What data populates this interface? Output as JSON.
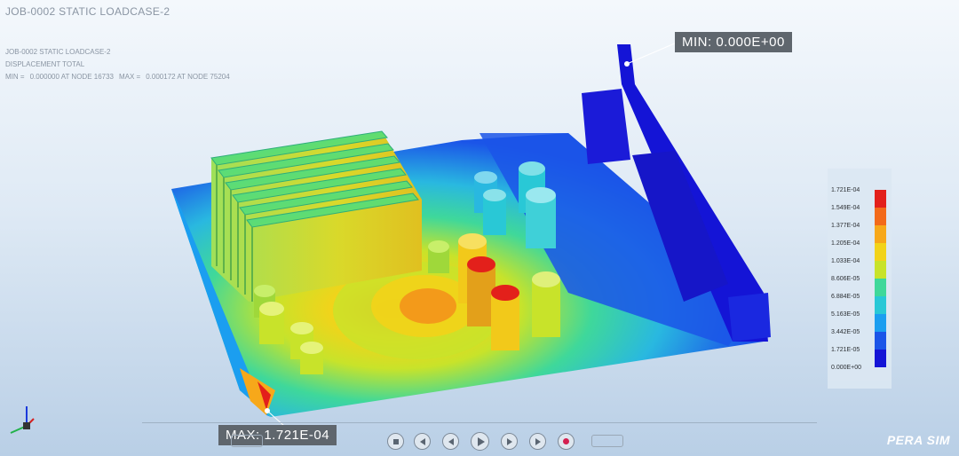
{
  "title": "JOB-0002 STATIC LOADCASE-2",
  "info": {
    "loadcase": "JOB-0002 STATIC LOADCASE-2",
    "result": "DISPLACEMENT TOTAL",
    "min_label": "MIN =",
    "min_value": "0.000000 AT NODE 16733",
    "max_label": "MAX =",
    "max_value": "0.000172 AT NODE 75204"
  },
  "callouts": {
    "min": "MIN: 0.000E+00",
    "max": "MAX: 1.721E-04"
  },
  "legend": {
    "labels": [
      "1.721E-04",
      "1.549E-04",
      "1.377E-04",
      "1.205E-04",
      "1.033E-04",
      "8.606E-05",
      "6.884E-05",
      "5.163E-05",
      "3.442E-05",
      "1.721E-05",
      "0.000E+00"
    ],
    "colors": [
      "#e3201b",
      "#f36a1a",
      "#f7a81a",
      "#f2d31a",
      "#c8e32a",
      "#7fe04a",
      "#3fd89a",
      "#29c8d6",
      "#1b9ef0",
      "#1b55e8",
      "#1414d6"
    ]
  },
  "player": {
    "buttons": [
      "stop-icon",
      "first-frame-icon",
      "step-back-icon",
      "play-icon",
      "step-forward-icon",
      "last-frame-icon",
      "record-icon"
    ]
  },
  "logo": "PERA SIM"
}
